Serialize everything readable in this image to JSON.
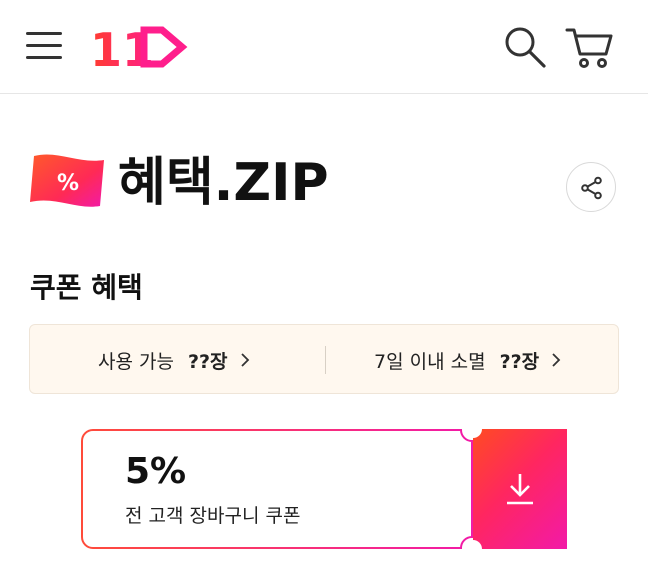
{
  "header": {
    "logo_text": "11",
    "icons": [
      "hamburger-menu-icon",
      "search-icon",
      "cart-icon"
    ]
  },
  "brand": {
    "badge_symbol": "%",
    "title": "혜택.ZIP",
    "share_icon": "share-icon"
  },
  "coupons_section": {
    "title": "쿠폰 혜택",
    "stats": [
      {
        "label": "사용 가능",
        "count": "??장"
      },
      {
        "label": "7일 이내 소멸",
        "count": "??장"
      }
    ]
  },
  "coupon_card": {
    "value": "5%",
    "description": "전 고객 장바구니 쿠폰",
    "download_icon": "download-icon"
  },
  "colors": {
    "accent_start": "#ff4b22",
    "accent_mid": "#ff2660",
    "accent_end": "#f21aa8",
    "stats_bg": "#fff8ef"
  }
}
